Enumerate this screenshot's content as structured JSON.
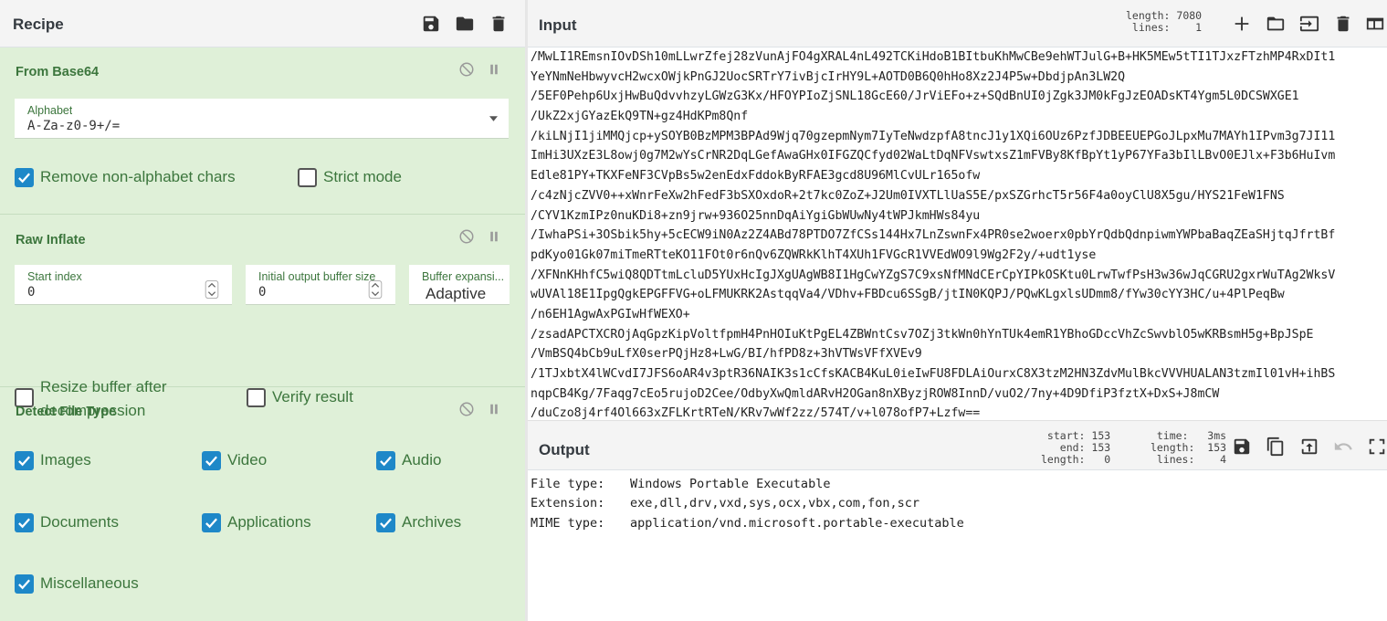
{
  "recipe": {
    "title": "Recipe",
    "operations": [
      {
        "title": "From Base64",
        "alphabet_label": "Alphabet",
        "alphabet_value": "A-Za-z0-9+/=",
        "remove_non_alphabet": {
          "label": "Remove non-alphabet chars",
          "checked": true
        },
        "strict_mode": {
          "label": "Strict mode",
          "checked": false
        }
      },
      {
        "title": "Raw Inflate",
        "start_index_label": "Start index",
        "start_index_value": "0",
        "initial_buffer_label": "Initial output buffer size",
        "initial_buffer_value": "0",
        "buffer_expansion_label": "Buffer expansi...",
        "buffer_expansion_value": "Adaptive",
        "resize_buffer": {
          "label_line1": "Resize buffer after",
          "label_line2": "decompression",
          "checked": false
        },
        "verify_result": {
          "label": "Verify result",
          "checked": false
        }
      },
      {
        "title": "Detect File Type",
        "types": [
          {
            "label": "Images",
            "checked": true
          },
          {
            "label": "Video",
            "checked": true
          },
          {
            "label": "Audio",
            "checked": true
          },
          {
            "label": "Documents",
            "checked": true
          },
          {
            "label": "Applications",
            "checked": true
          },
          {
            "label": "Archives",
            "checked": true
          },
          {
            "label": "Miscellaneous",
            "checked": true
          }
        ]
      }
    ]
  },
  "input": {
    "title": "Input",
    "length_label": "length:",
    "length_value": "7080",
    "lines_label": "lines:",
    "lines_value": "1",
    "lines": [
      "/MwLI1REmsnIOvDSh10mLLwrZfej28zVunAjFO4gXRAL4nL492TCKiHdoB1BItbuKhMwCBe9ehWTJulG+B+HK5MEw5tTI1TJxzFTzhMP4RxDIt1",
      "YeYNmNeHbwyvcH2wcxOWjkPnGJ2UocSRTrY7ivBjcIrHY9L+AOTD0B6Q0hHo8Xz2J4P5w+DbdjpAn3LW2Q",
      "/5EF0Pehp6UxjHwBuQdvvhzyLGWzG3Kx/HFOYPIoZjSNL18GcE60/JrViEFo+z+SQdBnUI0jZgk3JM0kFgJzEOADsKT4Ygm5L0DCSWXGE1",
      "/UkZ2xjGYazEkQ9TN+gz4HdKPm8Qnf",
      "/kiLNjI1jiMMQjcp+ySOYB0BzMPM3BPAd9Wjq70gzepmNym7IyTeNwdzpfA8tncJ1y1XQi6OUz6PzfJDBEEUEPGoJLpxMu7MAYh1IPvm3g7JI11",
      "ImHi3UXzE3L8owj0g7M2wYsCrNR2DqLGefAwaGHx0IFGZQCfyd02WaLtDqNFVswtxsZ1mFVBy8KfBpYt1yP67YFa3bIlLBvO0EJlx+F3b6HuIvm",
      "Edle81PY+TKXFeNF3CVpBs5w2enEdxFddokByRFAE3gcd8U96MlCvULr165ofw",
      "/c4zNjcZVV0++xWnrFeXw2hFedF3bSXOxdoR+2t7kc0ZoZ+J2Um0IVXTLlUaS5E/pxSZGrhcT5r56F4a0oyClU8X5gu/HYS21FeW1FNS",
      "/CYV1KzmIPz0nuKDi8+zn9jrw+936O25nnDqAiYgiGbWUwNy4tWPJkmHWs84yu",
      "/IwhaPSi+3OSbik5hy+5cECW9iN0Az2Z4ABd78PTDO7ZfCSs144Hx7LnZswnFx4PR0se2woerx0pbYrQdbQdnpiwmYWPbaBaqZEaSHjtqJfrtBf",
      "pdKyo01Gk07miTmeRTteKO11FOt0r6nQv6ZQWRkKlhT4XUh1FVGcR1VVEdWO9l9Wg2F2y/+udt1yse",
      "/XFNnKHhfC5wiQ8QDTtmLcluD5YUxHcIgJXgUAgWB8I1HgCwYZgS7C9xsNfMNdCErCpYIPkOSKtu0LrwTwfPsH3w36wJqCGRU2gxrWuTAg2WksV",
      "wUVAl18E1IpgQgkEPGFFVG+oLFMUKRK2AstqqVa4/VDhv+FBDcu6SSgB/jtIN0KQPJ/PQwKLgxlsUDmm8/fYw30cYY3HC/u+4PlPeqBw",
      "/n6EH1AgwAxPGIwHfWEXO+",
      "/zsadAPCTXCROjAqGpzKipVoltfpmH4PnHOIuKtPgEL4ZBWntCsv7OZj3tkWn0hYnTUk4emR1YBhoGDccVhZcSwvblO5wKRBsmH5g+BpJSpE",
      "/VmBSQ4bCb9uLfX0serPQjHz8+LwG/BI/hfPD8z+3hVTWsVFfXVEv9",
      "/1TJxbtX4lWCvdI7JFS6oAR4v3ptR36NAIK3s1cCfsKACB4KuL0ieIwFU8FDLAiOurxC8X3tzM2HN3ZdvMulBkcVVVHUALAN3tzmIl01vH+ihBS",
      "nqpCB4Kg/7Faqg7cEo5rujoD2Cee/OdbyXwQmldARvH2OGan8nXByzjROW8InnD/vuO2/7ny+4D9DfiP3fztX+DxS+J8mCW",
      "/duCzo8j4rf4Ol663xZFLKrtRTeN/KRv7wWf2zz/574T/v+l078ofP7+Lzfw=="
    ]
  },
  "output": {
    "title": "Output",
    "start_label": "start:",
    "start_value": "153",
    "end_label": "end:",
    "end_value": "153",
    "sel_length_label": "length:",
    "sel_length_value": "0",
    "time_label": "time:",
    "time_value": "3ms",
    "length_label": "length:",
    "length_value": "153",
    "lines_label": "lines:",
    "lines_value": "4",
    "rows": [
      {
        "key": "File type:",
        "value": "Windows Portable Executable"
      },
      {
        "key": "Extension:",
        "value": "exe,dll,drv,vxd,sys,ocx,vbx,com,fon,scr"
      },
      {
        "key": "MIME type:",
        "value": "application/vnd.microsoft.portable-executable"
      }
    ]
  },
  "colors": {
    "accent": "#1e88c8",
    "op_bg": "#dff0d8",
    "op_text": "#3c763d"
  }
}
